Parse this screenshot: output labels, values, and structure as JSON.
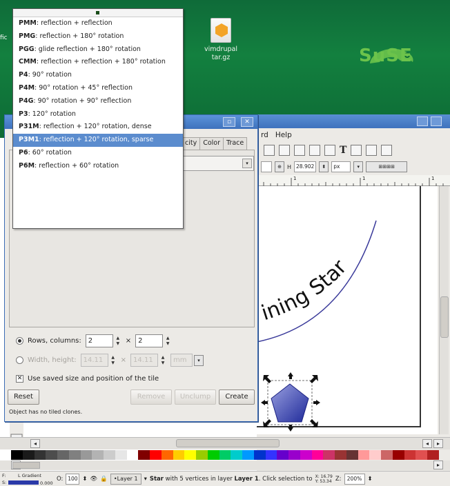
{
  "desktop": {
    "file_icon_label_1": "vimdrupal",
    "file_icon_label_2": "tar.gz",
    "logo_text": "SuSE",
    "left_fragment": "fic"
  },
  "inkscape": {
    "menu": [
      "rd",
      "Help"
    ],
    "ruler_labels": [
      "1",
      "1",
      "1"
    ],
    "height_label": "H",
    "height_value": "28.902",
    "unit": "px",
    "canvas_text": "Shining Star",
    "canvas_text_visible": "ining Star"
  },
  "tile_dialog": {
    "tabs": [
      "city",
      "Color",
      "Trace"
    ],
    "rows_columns_label": "Rows, columns:",
    "rows": "2",
    "times": "×",
    "columns": "2",
    "width_height_label": "Width, height:",
    "width_value": "14.11",
    "height_value": "14.11",
    "unit_value": "mm",
    "saved_size_label": "Use saved size and position of the tile",
    "reset_label": "Reset",
    "remove_label": "Remove",
    "unclump_label": "Unclump",
    "create_label": "Create",
    "status": "Object has no tiled clones."
  },
  "symmetry_dropdown": {
    "items": [
      {
        "code": "PMM",
        "desc": ": reflection + reflection"
      },
      {
        "code": "PMG",
        "desc": ": reflection + 180° rotation"
      },
      {
        "code": "PGG",
        "desc": ": glide reflection + 180° rotation"
      },
      {
        "code": "CMM",
        "desc": ": reflection + reflection + 180° rotation"
      },
      {
        "code": "P4",
        "desc": ": 90° rotation"
      },
      {
        "code": "P4M",
        "desc": ": 90° rotation + 45° reflection"
      },
      {
        "code": "P4G",
        "desc": ": 90° rotation + 90° reflection"
      },
      {
        "code": "P3",
        "desc": ": 120° rotation"
      },
      {
        "code": "P31M",
        "desc": ": reflection + 120° rotation, dense"
      },
      {
        "code": "P3M1",
        "desc": ": reflection + 120° rotation, sparse"
      },
      {
        "code": "P6",
        "desc": ": 60° rotation"
      },
      {
        "code": "P6M",
        "desc": ": reflection + 60° rotation"
      }
    ],
    "selected": "P3M1"
  },
  "statusbar": {
    "fill_label": "F:",
    "stroke_label": "S:",
    "gradient_label": "L Gradient",
    "stroke_width": "0.000",
    "opacity_label": "O:",
    "opacity_value": "100",
    "layer_label": "•Layer 1",
    "msg_1": "Star",
    "msg_2": " with 5 vertices in layer ",
    "msg_3": "Layer 1",
    "msg_4": ". Click selection to",
    "x_label": "X:",
    "x_value": "16.79",
    "y_label": "Y:",
    "y_value": "53.34",
    "z_label": "Z:",
    "zoom_value": "200%"
  },
  "colors": {
    "title_bar": "#3f73bd",
    "selection": "#5b8cce",
    "star_fill": "#2b3aa8",
    "desktop": "#13803f"
  },
  "palette": [
    "#000000",
    "#1a1a1a",
    "#333333",
    "#4d4d4d",
    "#666666",
    "#808080",
    "#999999",
    "#b3b3b3",
    "#cccccc",
    "#e6e6e6",
    "#ffffff",
    "#800000",
    "#ff0000",
    "#ff6600",
    "#ffcc00",
    "#ffff00",
    "#99cc00",
    "#00cc00",
    "#00cc66",
    "#00cccc",
    "#0099ff",
    "#0033cc",
    "#3333ff",
    "#6600cc",
    "#9900cc",
    "#cc00cc",
    "#ff0099",
    "#cc3366",
    "#993333",
    "#663333",
    "#ff9999",
    "#ffcccc",
    "#cc6666",
    "#990000",
    "#cc3333",
    "#e05050",
    "#b02020"
  ]
}
